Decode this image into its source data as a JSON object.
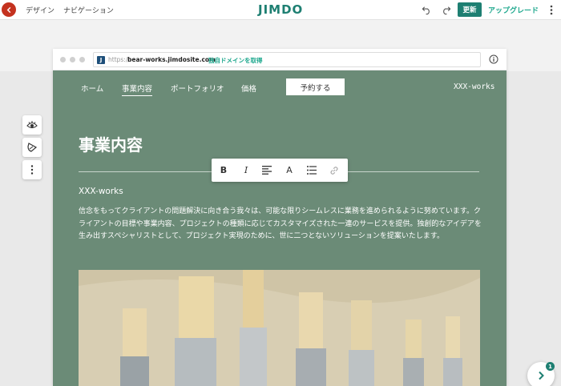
{
  "topbar": {
    "design_label": "デザイン",
    "navigation_label": "ナビゲーション",
    "logo_text": "JIMDO",
    "update_label": "更新",
    "upgrade_label": "アップグレード"
  },
  "browser": {
    "url_prefix": "https://",
    "url_host": "bear-works.jimdosite.com",
    "domain_link": "独自ドメインを取得"
  },
  "site": {
    "nav": [
      {
        "label": "ホーム"
      },
      {
        "label": "事業内容"
      },
      {
        "label": "ポートフォリオ"
      },
      {
        "label": "価格"
      }
    ],
    "reserve_label": "予約する",
    "brand": "XXX-works",
    "heading": "事業内容",
    "section_title": "XXX-works",
    "body": "信念をもってクライアントの問題解決に向き合う我々は、可能な限りシームレスに業務を進められるように努めています。クライアントの目標や事業内容、プロジェクトの種類に応じてカスタマイズされた一連のサービスを提供。独創的なアイデアを生み出すスペシャリストとして、プロジェクト実現のために、世に二つとないソリューションを提案いたします。"
  },
  "format_toolbar": {
    "bold": "B",
    "italic": "I",
    "font_size": "A"
  },
  "fab_badge": "1",
  "colors": {
    "brand": "#1e7f72",
    "site_bg": "#6b8b77",
    "back_button": "#c4321f"
  }
}
